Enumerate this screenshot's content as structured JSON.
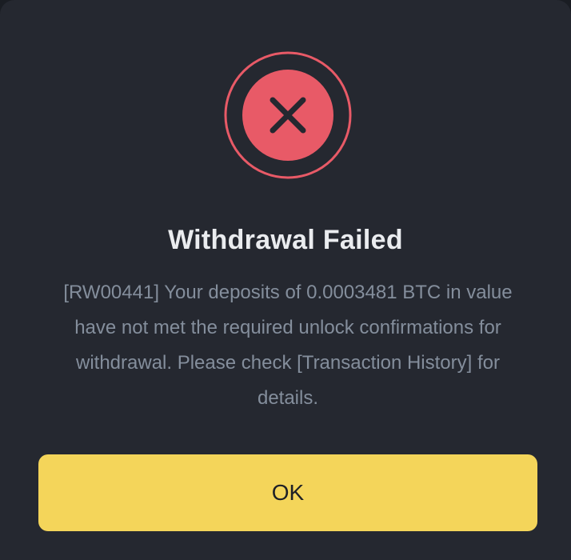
{
  "dialog": {
    "status_icon": "error-x-icon",
    "title": "Withdrawal Failed",
    "message": "[RW00441] Your deposits of 0.0003481 BTC in value have not met the required unlock confirmations for withdrawal. Please check [Transaction History] for details.",
    "ok_label": "OK"
  },
  "colors": {
    "background": "#252830",
    "error_red": "#e85a67",
    "button_yellow": "#f4d55a",
    "title_text": "#eaecef",
    "body_text": "#848e9c"
  }
}
